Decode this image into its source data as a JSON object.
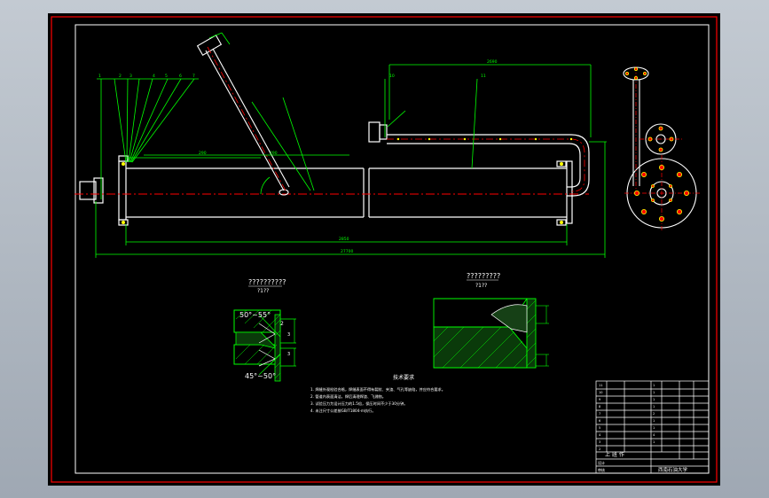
{
  "colors": {
    "viewport_bg": "#b4bcc6",
    "sheet": "#000000",
    "frame": "#ff0000",
    "outline": "#ffffff",
    "dims": "#00ff00",
    "centerline": "#ff0000",
    "bolts": "#ffff00",
    "hatch": "#00ff00"
  },
  "dims": {
    "top_span": "2690",
    "overall_length": "2850",
    "total_length": "27700",
    "small_a": "290",
    "small_b": "290"
  },
  "detail_left": {
    "title": "??????????",
    "scale": "?1??",
    "angle_top": "50°~55°",
    "angle_bottom": "45°~50°",
    "dim_2": "2"
  },
  "detail_right": {
    "title": "?????????",
    "scale": "?1??"
  },
  "notes": {
    "heading": "技术要求",
    "lines": [
      "1. 焊缝外观检验合格，焊缝表面不得有裂纹、夹渣、气孔等缺陷，并应符合要求。",
      "2. 管道内表面清洁，焊后清理焊渣、飞溅物。",
      "3. 试验压力为设计压力的1.5倍，保压时间不少于30分钟。",
      "4. 未注尺寸公差按GB/T1804-m执行。"
    ]
  },
  "title_block": {
    "school": "西南石油大学",
    "unit": "上 班 作",
    "row_labels": [
      "设计",
      "审核"
    ]
  }
}
